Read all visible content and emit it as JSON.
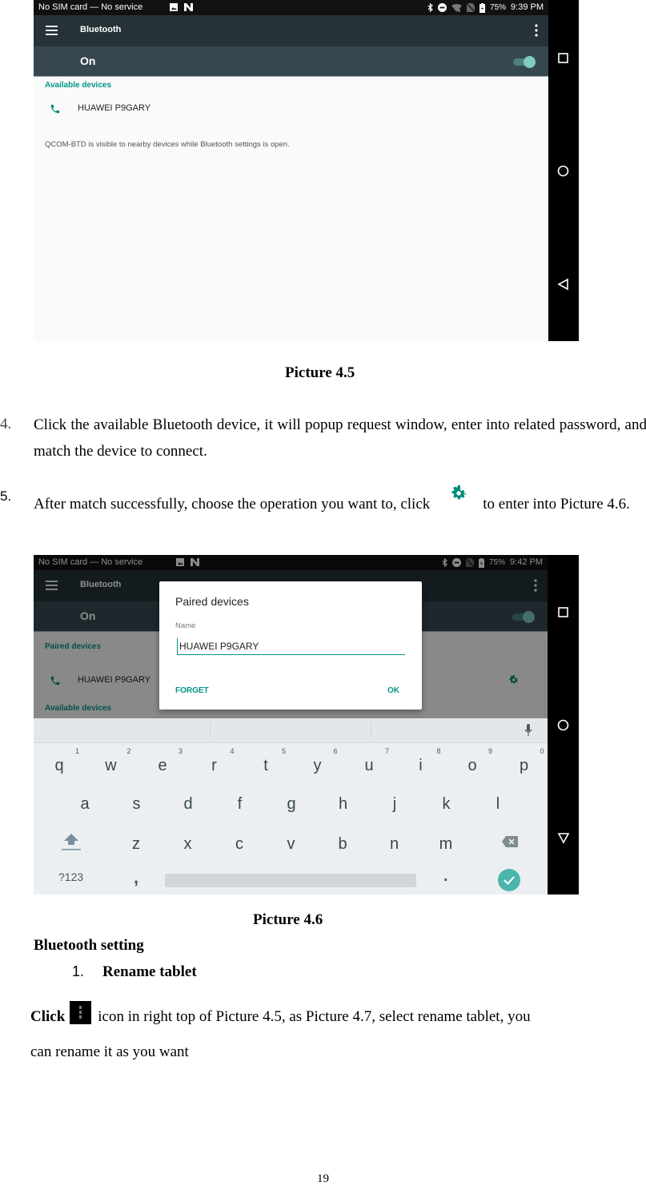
{
  "picture_4_5": {
    "status_bar": {
      "carrier": "No SIM card — No service",
      "battery": "75%",
      "time": "9:39 PM",
      "notification_icons": [
        "image-icon",
        "nfc-icon"
      ],
      "status_icons": [
        "bluetooth-icon",
        "do-not-disturb-icon",
        "wifi-off-icon",
        "no-sim-icon",
        "battery-charging-icon"
      ]
    },
    "toolbar": {
      "title": "Bluetooth",
      "menu_icon": "hamburger-icon",
      "more_icon": "more-vert-icon"
    },
    "switch": {
      "label": "On",
      "state": "on"
    },
    "available_devices_header": "Available devices",
    "devices": [
      {
        "name": "HUAWEI P9GARY",
        "icon": "phone-icon"
      }
    ],
    "visibility_hint": "QCOM-BTD is visible to nearby devices while Bluetooth settings is open.",
    "nav_buttons": [
      "recents-icon",
      "home-icon",
      "back-icon"
    ]
  },
  "caption_4_5": "Picture 4.5",
  "steps": [
    {
      "number": "4.",
      "text": "Click the available Bluetooth device, it will popup request window, enter into related password, and match the device to connect."
    },
    {
      "number": "5.",
      "text_before": "After match successfully, choose the operation you want to, click",
      "text_after": "to enter into Picture 4.6."
    }
  ],
  "picture_4_6": {
    "status_bar": {
      "carrier": "No SIM card — No service",
      "battery": "75%",
      "time": "9:42 PM"
    },
    "toolbar": {
      "title": "Bluetooth"
    },
    "switch": {
      "label": "On"
    },
    "paired_devices_header": "Paired devices",
    "paired_device": "HUAWEI P9GARY",
    "available_devices_header": "Available devices",
    "dialog": {
      "title": "Paired devices",
      "name_label": "Name",
      "name_value": "HUAWEI P9GARY",
      "forget_label": "FORGET",
      "ok_label": "OK"
    },
    "keyboard": {
      "row1": [
        "q",
        "w",
        "e",
        "r",
        "t",
        "y",
        "u",
        "i",
        "o",
        "p"
      ],
      "row1_hints": [
        "1",
        "2",
        "3",
        "4",
        "5",
        "6",
        "7",
        "8",
        "9",
        "0"
      ],
      "row2": [
        "a",
        "s",
        "d",
        "f",
        "g",
        "h",
        "j",
        "k",
        "l"
      ],
      "row3": [
        "z",
        "x",
        "c",
        "v",
        "b",
        "n",
        "m"
      ],
      "symbols_key": "?123",
      "comma_key": ",",
      "period_key": "."
    }
  },
  "caption_4_6": "Picture 4.6",
  "section_title": "Bluetooth setting",
  "subsection": {
    "number": "1.",
    "title": "Rename tablet"
  },
  "rename_paragraph": {
    "bold_lead": "Click",
    "line1": "icon in right top of Picture 4.5, as Picture 4.7, select rename tablet, you",
    "line2": "can rename it as you want"
  },
  "page_number": "19",
  "colors": {
    "accent": "#009688",
    "toolbar": "#263238",
    "switchbar": "#37474f"
  }
}
